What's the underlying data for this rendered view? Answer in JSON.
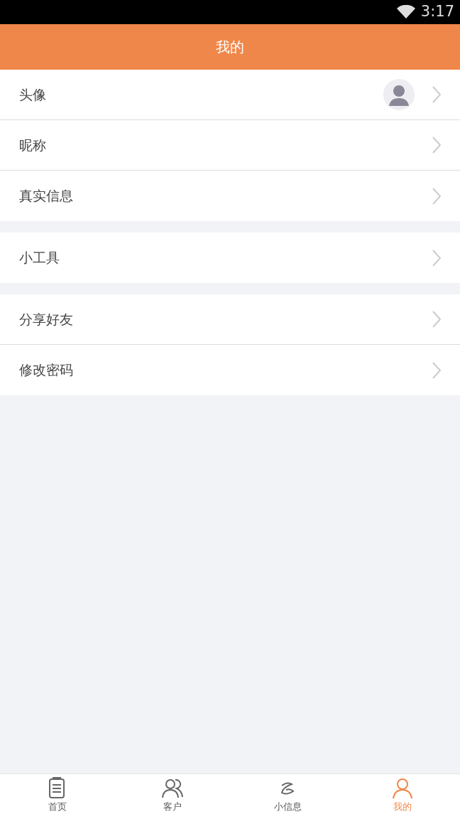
{
  "status_bar": {
    "time": "3:17"
  },
  "header": {
    "title": "我的"
  },
  "groups": [
    {
      "items": [
        {
          "label": "头像",
          "kind": "avatar"
        },
        {
          "label": "昵称",
          "kind": "plain"
        },
        {
          "label": "真实信息",
          "kind": "plain"
        }
      ]
    },
    {
      "items": [
        {
          "label": "小工具",
          "kind": "plain"
        }
      ]
    },
    {
      "items": [
        {
          "label": "分享好友",
          "kind": "plain"
        },
        {
          "label": "修改密码",
          "kind": "plain"
        }
      ]
    }
  ],
  "tab_bar": [
    {
      "label": "首页",
      "selected": false
    },
    {
      "label": "客户",
      "selected": false
    },
    {
      "label": "小信息",
      "selected": false
    },
    {
      "label": "我的",
      "selected": true
    }
  ]
}
